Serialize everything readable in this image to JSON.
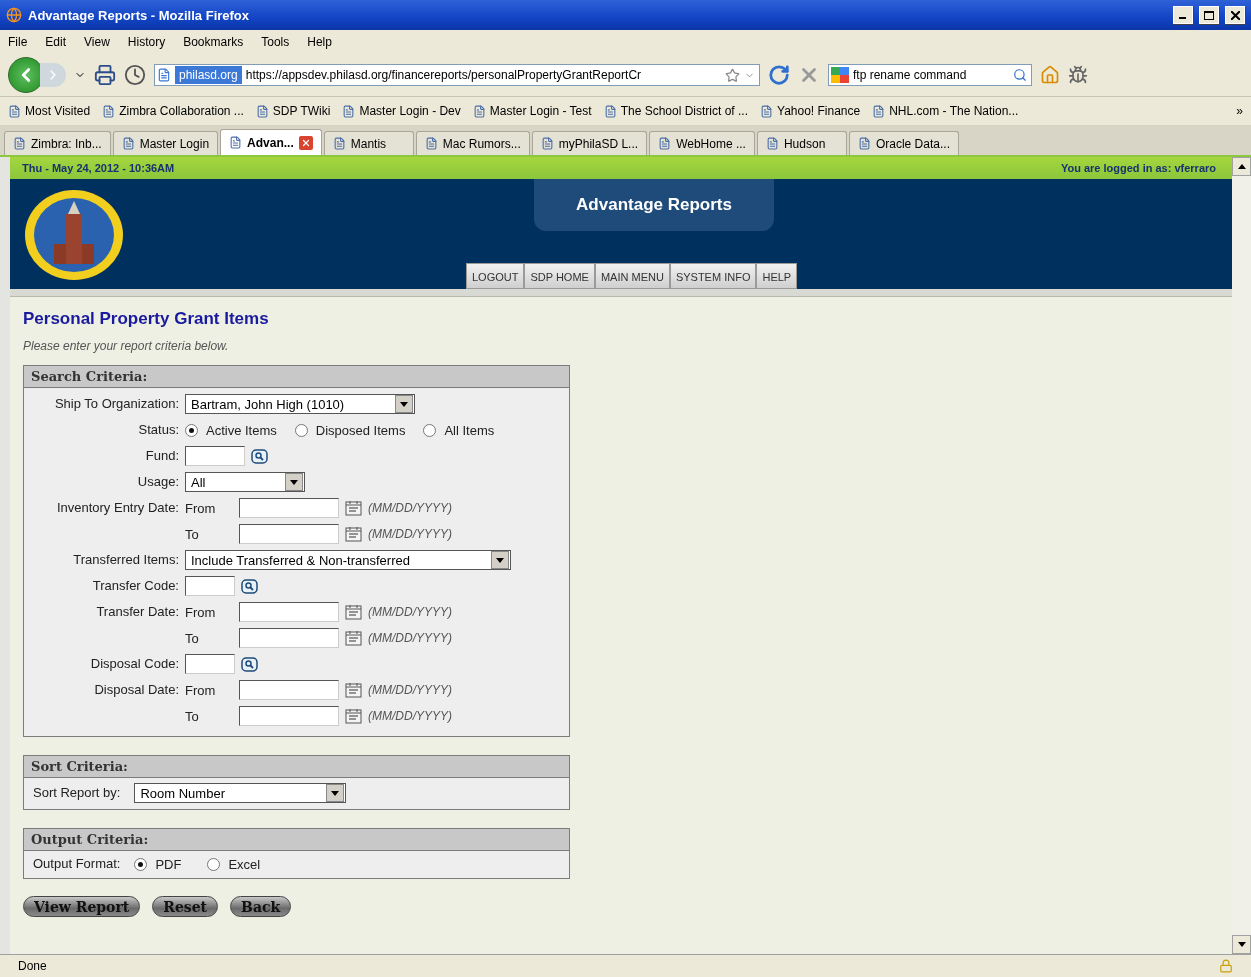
{
  "window": {
    "title": "Advantage Reports - Mozilla Firefox"
  },
  "menu": [
    "File",
    "Edit",
    "View",
    "History",
    "Bookmarks",
    "Tools",
    "Help"
  ],
  "navbar": {
    "site_badge": "philasd.org",
    "url": "https://appsdev.philasd.org/financereports/personalPropertyGrantReportCr",
    "search_value": "ftp rename command"
  },
  "bookmarks": [
    "Most Visited",
    "Zimbra Collaboration ...",
    "SDP TWiki",
    "Master Login - Dev",
    "Master Login - Test",
    "The School District of ...",
    "Yahoo! Finance",
    "NHL.com - The Nation..."
  ],
  "bookmarks_more": "»",
  "tabs": [
    {
      "label": "Zimbra: Inb...",
      "selected": false
    },
    {
      "label": "Master Login",
      "selected": false
    },
    {
      "label": "Advan...",
      "selected": true
    },
    {
      "label": "Mantis",
      "selected": false
    },
    {
      "label": "Mac Rumors...",
      "selected": false
    },
    {
      "label": "myPhilaSD L...",
      "selected": false
    },
    {
      "label": "WebHome ...",
      "selected": false
    },
    {
      "label": "Hudson",
      "selected": false
    },
    {
      "label": "Oracle Data...",
      "selected": false
    }
  ],
  "page": {
    "date": "Thu - May 24, 2012 - 10:36AM",
    "logged_in": "You are logged in as: vferraro",
    "app_title": "Advantage Reports",
    "nav_links": [
      "LOGOUT",
      "SDP HOME",
      "MAIN MENU",
      "SYSTEM INFO",
      "HELP"
    ],
    "heading": "Personal Property Grant Items",
    "instructions": "Please enter your report criteria below.",
    "search_criteria": {
      "title": "Search Criteria:",
      "rows": [
        {
          "kind": "select",
          "label": "Ship To Organization:",
          "value": "Bartram, John High (1010)"
        },
        {
          "kind": "radio",
          "label": "Status:",
          "options": [
            {
              "label": "Active Items",
              "selected": true
            },
            {
              "label": "Disposed Items",
              "selected": false
            },
            {
              "label": "All Items",
              "selected": false
            }
          ]
        },
        {
          "kind": "lookup",
          "label": "Fund:"
        },
        {
          "kind": "select",
          "label": "Usage:",
          "value": "All"
        },
        {
          "kind": "date",
          "label": "Inventory Entry Date:",
          "bound": "From",
          "hint": "(MM/DD/YYYY)"
        },
        {
          "kind": "date",
          "bound": "To",
          "hint": "(MM/DD/YYYY)"
        },
        {
          "kind": "select",
          "label": "Transferred Items:",
          "value": "Include Transferred & Non-transferred"
        },
        {
          "kind": "lookup",
          "label": "Transfer Code:"
        },
        {
          "kind": "date",
          "label": "Transfer Date:",
          "bound": "From",
          "hint": "(MM/DD/YYYY)"
        },
        {
          "kind": "date",
          "bound": "To",
          "hint": "(MM/DD/YYYY)"
        },
        {
          "kind": "lookup",
          "label": "Disposal Code:"
        },
        {
          "kind": "date",
          "label": "Disposal Date:",
          "bound": "From",
          "hint": "(MM/DD/YYYY)"
        },
        {
          "kind": "date",
          "bound": "To",
          "hint": "(MM/DD/YYYY)"
        }
      ]
    },
    "sort_criteria": {
      "title": "Sort Criteria:",
      "label": "Sort Report by:",
      "value": "Room Number"
    },
    "output_criteria": {
      "title": "Output Criteria:",
      "label": "Output Format:",
      "options": [
        {
          "label": "PDF",
          "selected": true
        },
        {
          "label": "Excel",
          "selected": false
        }
      ]
    },
    "buttons": [
      "View Report",
      "Reset",
      "Back"
    ]
  },
  "status_bar": {
    "text": "Done"
  }
}
